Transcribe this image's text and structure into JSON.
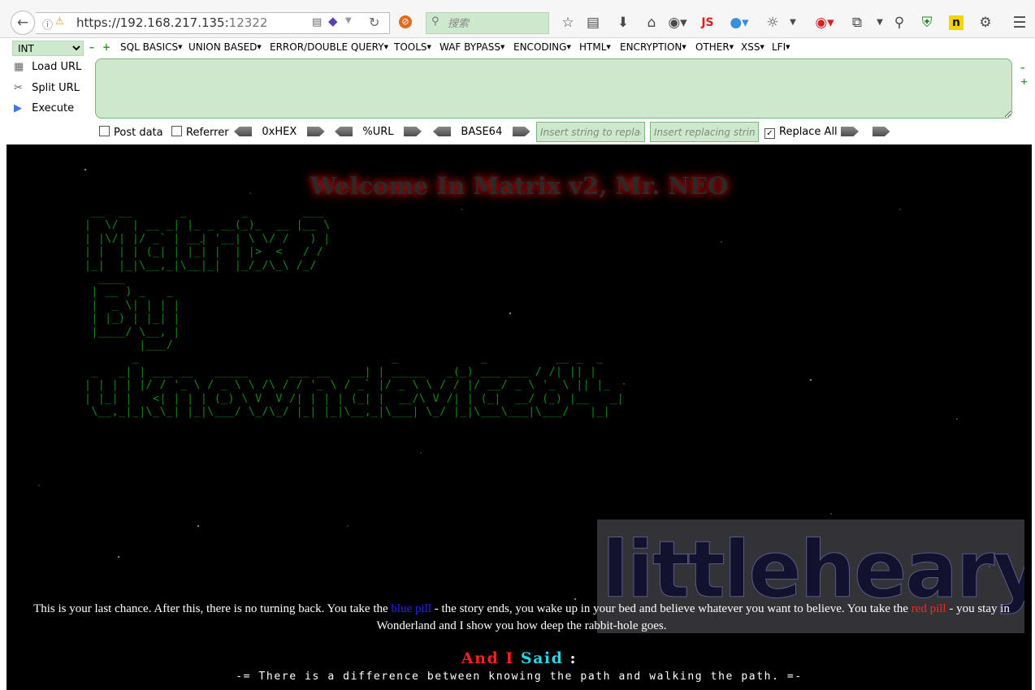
{
  "browser": {
    "url_host": "https://192.168.217.135:",
    "url_port": "12322",
    "search_placeholder": "搜索",
    "js_label": "JS"
  },
  "hackbar": {
    "select_value": "INT",
    "menus": [
      "SQL BASICS",
      "UNION BASED",
      "ERROR/DOUBLE QUERY",
      "TOOLS",
      "WAF BYPASS",
      "ENCODING",
      "HTML",
      "ENCRYPTION",
      "OTHER",
      "XSS",
      "LFI"
    ],
    "load_url": "Load URL",
    "split_url": "Split URL",
    "execute": "Execute",
    "post_data": "Post data",
    "referrer": "Referrer",
    "hex": "0xHEX",
    "url_enc": "%URL",
    "base64": "BASE64",
    "replace_placeholder": "Insert string to replace",
    "replacing_placeholder": "Insert replacing string",
    "replace_all": "Replace All"
  },
  "page": {
    "welcome": "Welcome In Matrix v2, Mr. NEO",
    "ascii_art": " __  __       _        _        ___\n|  \\/  | __ _| |_ _ __(_)_  __ |__ \\\n| |\\/| |/ _` | __| '__| \\ \\/ /   ) |\n| |  | | (_| | |_| |  | |>  <   / /\n|_|  |_|\\__,_|\\__|_|  |_/_/\\_\\ /_/\n  ____\n | __ ) _   _\n |  _ \\| | | |\n | |_) | |_| |\n |____/ \\__, |\n        |___/\n       _                                     _            _          __ _  _\n _   _| | ___ __   _____      ___ __   __| | _____   _(_) ___ ___ / /| || |\n| | | | |/ / '_ \\ / _ \\ \\ /\\ / / '_ \\ / _` |/ _ \\ \\ / / |/ __/ _ \\ '_ \\ || |_\n| |_| |   <| | | | (_) \\ V  V /| | | | (_| |  __/\\ V /| | (_|  __/ (_) |__   _|\n \\__,_|_|\\_\\_| |_|\\___/ \\_/\\_/ |_| |_|\\__,_|\\___| \\_/ |_|\\___\\___|\\___/   |_|",
    "quote_before": "This is your last chance. After this, there is no turning back. You take the ",
    "blue_pill": "blue pill",
    "quote_middle": " - the story ends, you wake up in your bed and believe whatever you want to believe. You take the ",
    "red_pill": "red pill",
    "quote_after": " - you stay in Wonderland and I show you how deep the rabbit-hole goes.",
    "said_and_i": "And I",
    "said_said": " Said",
    "said_colon": " :",
    "tagline": "-= There is a difference between knowing the path and walking the path. =-",
    "watermark": "littleheary"
  },
  "colors": {
    "ascii_green": "#0c8a14",
    "blue_pill": "#2222ff",
    "red_pill": "#ff2222",
    "said_red": "#ff1e1e",
    "said_cyan": "#2ad6e6",
    "hackbar_green": "#cde8cd"
  },
  "icons": [
    "back-arrow-icon",
    "info-icon",
    "warning-lock-icon",
    "reload-icon",
    "noscript-icon",
    "search-icon",
    "bookmark-star-icon",
    "reader-icon",
    "download-icon",
    "home-icon",
    "settings-icon",
    "menu-icon"
  ]
}
